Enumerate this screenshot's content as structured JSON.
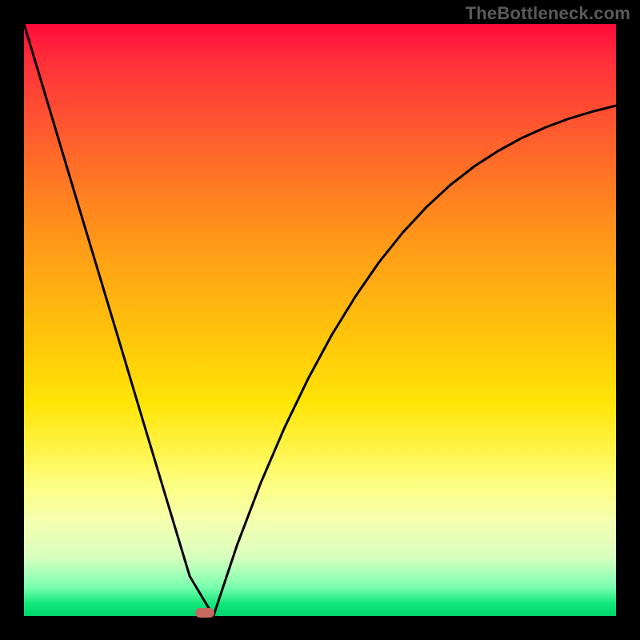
{
  "watermark": "TheBottleneck.com",
  "colors": {
    "frame": "#000000",
    "curve": "#000000",
    "marker": "#c46a61"
  },
  "chart_data": {
    "type": "line",
    "title": "",
    "xlabel": "",
    "ylabel": "",
    "xlim": [
      0,
      100
    ],
    "ylim": [
      0,
      100
    ],
    "grid": false,
    "legend": false,
    "series": [
      {
        "name": "curve",
        "x": [
          0,
          4,
          8,
          12,
          16,
          20,
          24,
          28,
          32,
          36,
          40,
          44,
          48,
          52,
          56,
          60,
          64,
          68,
          72,
          76,
          80,
          84,
          88,
          92,
          96,
          100
        ],
        "y": [
          100,
          86.7,
          73.3,
          60.0,
          46.7,
          33.3,
          20.0,
          6.7,
          0.0,
          12.0,
          22.5,
          31.8,
          40.1,
          47.5,
          54.0,
          59.8,
          64.8,
          69.1,
          72.8,
          75.9,
          78.5,
          80.7,
          82.5,
          84.0,
          85.2,
          86.2
        ],
        "color": "#000000"
      }
    ],
    "annotations": [
      {
        "type": "marker",
        "x": 30.5,
        "y": 0.5,
        "shape": "pill",
        "color": "#c46a61"
      }
    ],
    "background_gradient": {
      "direction": "vertical",
      "stops": [
        {
          "pos": 0.0,
          "color": "#ff0a3a"
        },
        {
          "pos": 0.3,
          "color": "#ff831f"
        },
        {
          "pos": 0.55,
          "color": "#ffc80a"
        },
        {
          "pos": 0.78,
          "color": "#fdff84"
        },
        {
          "pos": 0.92,
          "color": "#b8ffb8"
        },
        {
          "pos": 1.0,
          "color": "#00d46c"
        }
      ]
    }
  }
}
